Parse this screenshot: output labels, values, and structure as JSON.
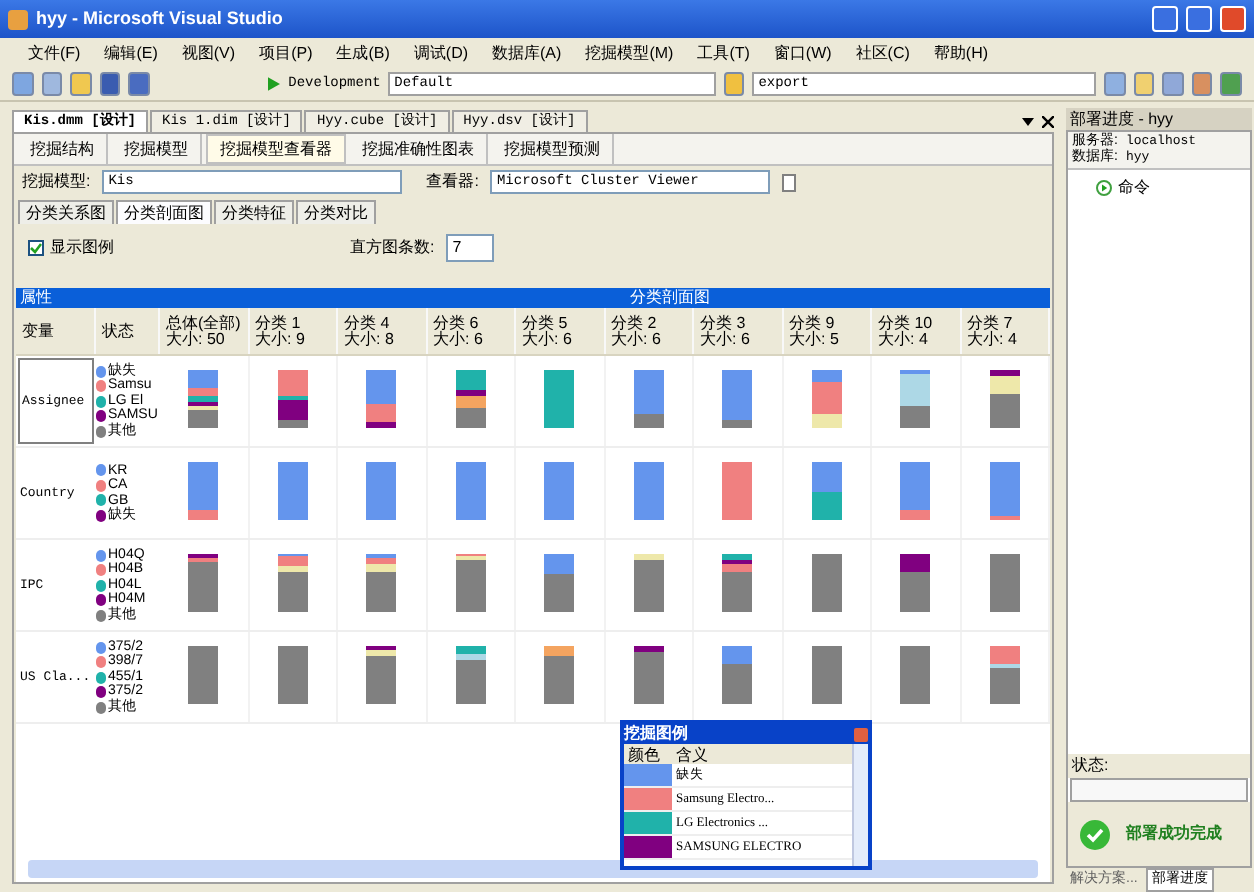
{
  "window": {
    "title": "hyy - Microsoft Visual Studio"
  },
  "menu": [
    "文件(F)",
    "编辑(E)",
    "视图(V)",
    "项目(P)",
    "生成(B)",
    "调试(D)",
    "数据库(A)",
    "挖掘模型(M)",
    "工具(T)",
    "窗口(W)",
    "社区(C)",
    "帮助(H)"
  ],
  "toolbar": {
    "configuration": "Development",
    "platform": "Default",
    "find": "export"
  },
  "document_tabs": [
    {
      "label": "Kis.dmm [设计]",
      "selected": true
    },
    {
      "label": "Kis 1.dim [设计]",
      "selected": false
    },
    {
      "label": "Hyy.cube [设计]",
      "selected": false
    },
    {
      "label": "Hyy.dsv [设计]",
      "selected": false
    }
  ],
  "designer_tabs": [
    {
      "label": "挖掘结构",
      "selected": false
    },
    {
      "label": "挖掘模型",
      "selected": false
    },
    {
      "label": "挖掘模型查看器",
      "selected": true
    },
    {
      "label": "挖掘准确性图表",
      "selected": false
    },
    {
      "label": "挖掘模型预测",
      "selected": false
    }
  ],
  "model_selector": {
    "label": "挖掘模型:",
    "value": "Kis"
  },
  "viewer_selector": {
    "label": "查看器:",
    "value": "Microsoft Cluster Viewer"
  },
  "viewer_tabs": [
    {
      "label": "分类关系图",
      "selected": false
    },
    {
      "label": "分类剖面图",
      "selected": true
    },
    {
      "label": "分类特征",
      "selected": false
    },
    {
      "label": "分类对比",
      "selected": false
    }
  ],
  "show_legend": {
    "label": "显示图例",
    "checked": true
  },
  "histogram_bars": {
    "label": "直方图条数:",
    "value": "7"
  },
  "profile": {
    "left_header": "属性",
    "right_header": "分类剖面图",
    "columns": [
      {
        "title": "变量"
      },
      {
        "title": "状态"
      },
      {
        "title": "总体(全部)",
        "size": "大小: 50"
      },
      {
        "title": "分类 1",
        "size": "大小: 9"
      },
      {
        "title": "分类 4",
        "size": "大小: 8"
      },
      {
        "title": "分类 6",
        "size": "大小: 6"
      },
      {
        "title": "分类 5",
        "size": "大小: 6"
      },
      {
        "title": "分类 2",
        "size": "大小: 6"
      },
      {
        "title": "分类 3",
        "size": "大小: 6"
      },
      {
        "title": "分类 9",
        "size": "大小: 5"
      },
      {
        "title": "分类 10",
        "size": "大小: 4"
      },
      {
        "title": "分类 7",
        "size": "大小: 4"
      }
    ],
    "rows": [
      {
        "variable": "Assignee",
        "selected": true,
        "states": [
          {
            "label": "缺失",
            "color": "#6495ed"
          },
          {
            "label": "Samsu",
            "color": "#f08080"
          },
          {
            "label": "LG El",
            "color": "#20b2aa"
          },
          {
            "label": "SAMSU",
            "color": "#800080"
          },
          {
            "label": "其他",
            "color": "#808080"
          }
        ]
      },
      {
        "variable": "Country",
        "selected": false,
        "states": [
          {
            "label": "KR",
            "color": "#6495ed"
          },
          {
            "label": "CA",
            "color": "#f08080"
          },
          {
            "label": "GB",
            "color": "#20b2aa"
          },
          {
            "label": "缺失",
            "color": "#800080"
          }
        ]
      },
      {
        "variable": "IPC",
        "selected": false,
        "states": [
          {
            "label": "H04Q",
            "color": "#6495ed"
          },
          {
            "label": "H04B",
            "color": "#f08080"
          },
          {
            "label": "H04L",
            "color": "#20b2aa"
          },
          {
            "label": "H04M",
            "color": "#800080"
          },
          {
            "label": "其他",
            "color": "#808080"
          }
        ]
      },
      {
        "variable": "US Cla...",
        "selected": false,
        "states": [
          {
            "label": "375/2",
            "color": "#6495ed"
          },
          {
            "label": "398/7",
            "color": "#f08080"
          },
          {
            "label": "455/1",
            "color": "#20b2aa"
          },
          {
            "label": "375/2",
            "color": "#800080"
          },
          {
            "label": "其他",
            "color": "#808080"
          }
        ]
      }
    ]
  },
  "legend": {
    "title": "挖掘图例",
    "columns": [
      "颜色",
      "含义"
    ],
    "items": [
      {
        "label": "缺失",
        "color": "#6495ed"
      },
      {
        "label": "Samsung Electro...",
        "color": "#f08080"
      },
      {
        "label": "LG Electronics ...",
        "color": "#20b2aa"
      },
      {
        "label": "SAMSUNG ELECTRO",
        "color": "#800080"
      }
    ]
  },
  "deploy_panel": {
    "title": "部署进度 - hyy",
    "server_label": "服务器:",
    "server": "localhost",
    "database_label": "数据库:",
    "database": "hyy",
    "command": "命令",
    "status_label": "状态:",
    "status": "部署成功完成"
  },
  "bottom_tabs": [
    {
      "label": "解决方案...",
      "selected": false
    },
    {
      "label": "部署进度",
      "selected": true
    }
  ]
}
